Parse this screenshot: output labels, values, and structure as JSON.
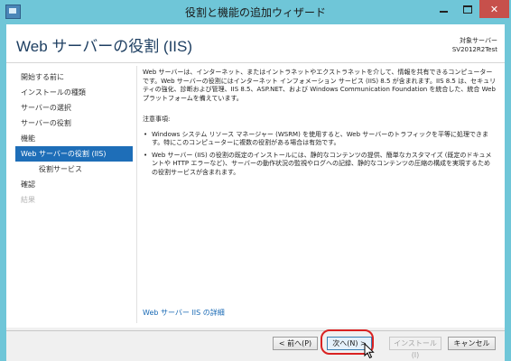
{
  "window": {
    "title": "役割と機能の追加ウィザード"
  },
  "header": {
    "page_title": "Web サーバーの役割 (IIS)",
    "server_caption": "対象サーバー",
    "server_name": "SV2012R2Test"
  },
  "nav": {
    "items": [
      {
        "label": "開始する前に",
        "state": "normal"
      },
      {
        "label": "インストールの種類",
        "state": "normal"
      },
      {
        "label": "サーバーの選択",
        "state": "normal"
      },
      {
        "label": "サーバーの役割",
        "state": "normal"
      },
      {
        "label": "機能",
        "state": "normal"
      },
      {
        "label": "Web サーバーの役割 (IIS)",
        "state": "active"
      },
      {
        "label": "役割サービス",
        "state": "sub"
      },
      {
        "label": "確認",
        "state": "normal"
      },
      {
        "label": "結果",
        "state": "disabled"
      }
    ]
  },
  "content": {
    "description": "Web サーバーは、インターネット、またはイントラネットやエクストラネットを介して、情報を共有できるコンピューターです。Web サーバーの役割にはインターネット インフォメーション サービス (IIS) 8.5 が含まれます。IIS 8.5 は、セキュリティの強化、診断および管理、IIS 8.5、ASP.NET、および Windows Communication Foundation を統合した、統合 Web プラットフォームを備えています。",
    "notes_heading": "注意事項:",
    "notes": [
      "Windows システム リソース マネージャー (WSRM) を使用すると、Web サーバーのトラフィックを平等に処理できます。特にこのコンピューターに複数の役割がある場合は有効です。",
      "Web サーバー (IIS) の役割の既定のインストールには、静的なコンテンツの提供、簡単なカスタマイズ (既定のドキュメントや HTTP エラーなど)、サーバーの動作状況の監視やログへの記録、静的なコンテンツの圧縮の構成を実現するための役割サービスが含まれます。"
    ],
    "details_link": "Web サーバー IIS の詳細"
  },
  "footer": {
    "prev_label": "< 前へ(P)",
    "next_label": "次へ(N) >",
    "install_label": "インストール(I)",
    "cancel_label": "キャンセル"
  },
  "icons": {
    "app": "server-manager-icon",
    "minimize": "minimize-icon",
    "maximize": "maximize-icon",
    "close": "close-icon",
    "cursor": "mouse-pointer-icon"
  },
  "colors": {
    "titlebar": "#6fc6d8",
    "nav_active": "#1e6eb8",
    "title_text": "#1e3f62",
    "link": "#1a6ab5",
    "highlight": "#d92222"
  }
}
